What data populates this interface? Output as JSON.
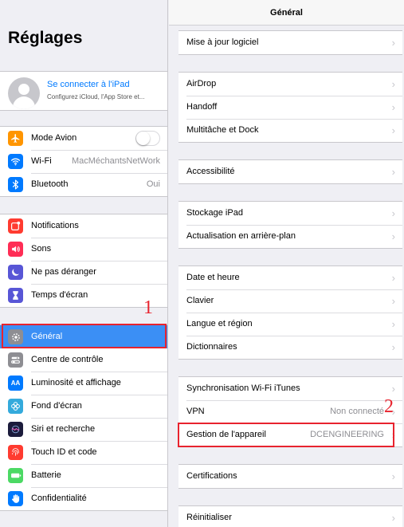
{
  "sidebar": {
    "title": "Réglages",
    "profile": {
      "link": "Se connecter à l'iPad",
      "subtitle": "Configurez iCloud, l'App Store et..."
    },
    "network": [
      {
        "label": "Mode Avion",
        "icon": "airplane-icon",
        "color": "#ff9500",
        "toggle": false
      },
      {
        "label": "Wi-Fi",
        "icon": "wifi-icon",
        "color": "#007aff",
        "value": "MacMéchantsNetWork"
      },
      {
        "label": "Bluetooth",
        "icon": "bluetooth-icon",
        "color": "#007aff",
        "value": "Oui"
      }
    ],
    "notifications": [
      {
        "label": "Notifications",
        "icon": "notifications-icon",
        "color": "#ff3b30"
      },
      {
        "label": "Sons",
        "icon": "speaker-icon",
        "color": "#ff2d55"
      },
      {
        "label": "Ne pas déranger",
        "icon": "moon-icon",
        "color": "#5856d6"
      },
      {
        "label": "Temps d'écran",
        "icon": "hourglass-icon",
        "color": "#5856d6"
      }
    ],
    "general": [
      {
        "label": "Général",
        "icon": "gear-icon",
        "color": "#8e8e93",
        "selected": true
      },
      {
        "label": "Centre de contrôle",
        "icon": "control-center-icon",
        "color": "#8e8e93"
      },
      {
        "label": "Luminosité et affichage",
        "icon": "brightness-icon",
        "color": "#007aff"
      },
      {
        "label": "Fond d'écran",
        "icon": "wallpaper-icon",
        "color": "#34aadc"
      },
      {
        "label": "Siri et recherche",
        "icon": "siri-icon",
        "color": "#1c1c3c"
      },
      {
        "label": "Touch ID et code",
        "icon": "fingerprint-icon",
        "color": "#ff3b30"
      },
      {
        "label": "Batterie",
        "icon": "battery-icon",
        "color": "#4cd964"
      },
      {
        "label": "Confidentialité",
        "icon": "hand-icon",
        "color": "#007aff"
      }
    ]
  },
  "detail": {
    "title": "Général",
    "groups": [
      [
        {
          "label": "Mise à jour logiciel"
        }
      ],
      [
        {
          "label": "AirDrop"
        },
        {
          "label": "Handoff"
        },
        {
          "label": "Multitâche et Dock"
        }
      ],
      [
        {
          "label": "Accessibilité"
        }
      ],
      [
        {
          "label": "Stockage iPad"
        },
        {
          "label": "Actualisation en arrière-plan"
        }
      ],
      [
        {
          "label": "Date et heure"
        },
        {
          "label": "Clavier"
        },
        {
          "label": "Langue et région"
        },
        {
          "label": "Dictionnaires"
        }
      ],
      [
        {
          "label": "Synchronisation Wi-Fi iTunes"
        },
        {
          "label": "VPN",
          "value": "Non connecté"
        },
        {
          "label": "Gestion de l'appareil",
          "value": "DCENGINEERING"
        }
      ],
      [
        {
          "label": "Certifications"
        }
      ],
      [
        {
          "label": "Réinitialiser"
        }
      ]
    ]
  },
  "annotations": {
    "marker_1": "1",
    "marker_2": "2",
    "color": "#e8232e"
  }
}
